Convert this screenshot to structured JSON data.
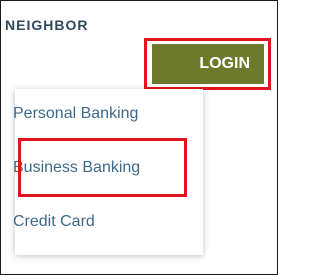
{
  "brand_text": "NEIGHBOR",
  "login_label": "LOGIN",
  "menu": {
    "items": [
      {
        "label": "Personal Banking"
      },
      {
        "label": "Business Banking"
      },
      {
        "label": "Credit Card"
      }
    ]
  },
  "colors": {
    "login_bg": "#6e7a2b",
    "highlight": "#e1141e",
    "menu_text": "#3d6a8a",
    "brand_text": "#2f4a5c"
  }
}
